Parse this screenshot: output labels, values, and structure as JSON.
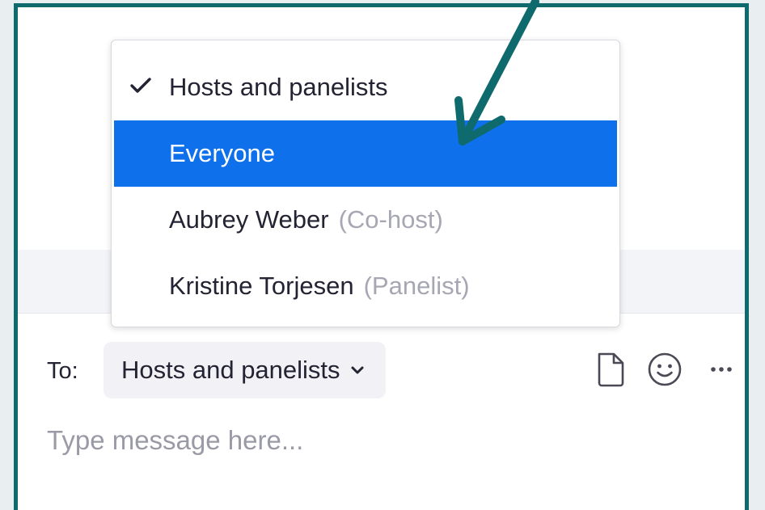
{
  "chat": {
    "menu": {
      "items": [
        {
          "label": "Hosts and panelists",
          "role": "",
          "checked": true,
          "highlighted": false
        },
        {
          "label": "Everyone",
          "role": "",
          "checked": false,
          "highlighted": true
        },
        {
          "label": "Aubrey Weber",
          "role": "(Co-host)",
          "checked": false,
          "highlighted": false
        },
        {
          "label": "Kristine Torjesen",
          "role": "(Panelist)",
          "checked": false,
          "highlighted": false
        }
      ]
    },
    "to_label": "To:",
    "recipient": "Hosts and panelists",
    "placeholder": "Type message here...",
    "icons": [
      "file-icon",
      "emoji-icon",
      "more-options-icon"
    ]
  },
  "colors": {
    "frame": "#0f6a6d",
    "highlight": "#0e71eb",
    "arrow": "#0f6a6d"
  }
}
